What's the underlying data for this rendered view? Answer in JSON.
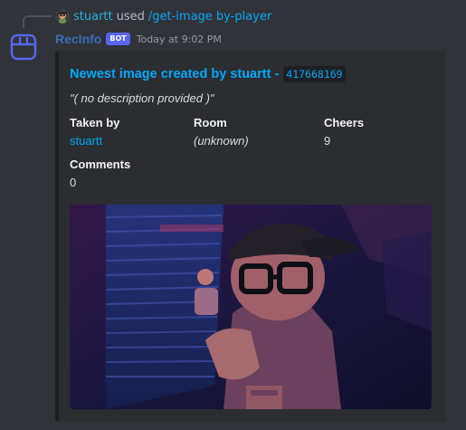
{
  "reply": {
    "username": "stuartt",
    "used": "used",
    "command": "/get-image by-player"
  },
  "author": {
    "name": "RecInfo",
    "bot_tag": "BOT",
    "timestamp": "Today at 9:02 PM"
  },
  "embed": {
    "title": "Newest image created by stuartt -",
    "image_id": "417668169",
    "description": "\"( no description provided )\"",
    "fields": {
      "taken_by": {
        "name": "Taken by",
        "value": "stuartt"
      },
      "room": {
        "name": "Room",
        "value": "(unknown)"
      },
      "cheers": {
        "name": "Cheers",
        "value": "9"
      },
      "comments": {
        "name": "Comments",
        "value": "0"
      }
    }
  },
  "colors": {
    "background": "#313338",
    "embed_background": "#2b2d31",
    "link": "#00a8fc",
    "bot_tag": "#5865f2",
    "author_name": "#3a6db8"
  },
  "icons": {
    "bot_avatar": "recinfo-logo-icon",
    "reply_avatar": "user-avatar-icon"
  }
}
